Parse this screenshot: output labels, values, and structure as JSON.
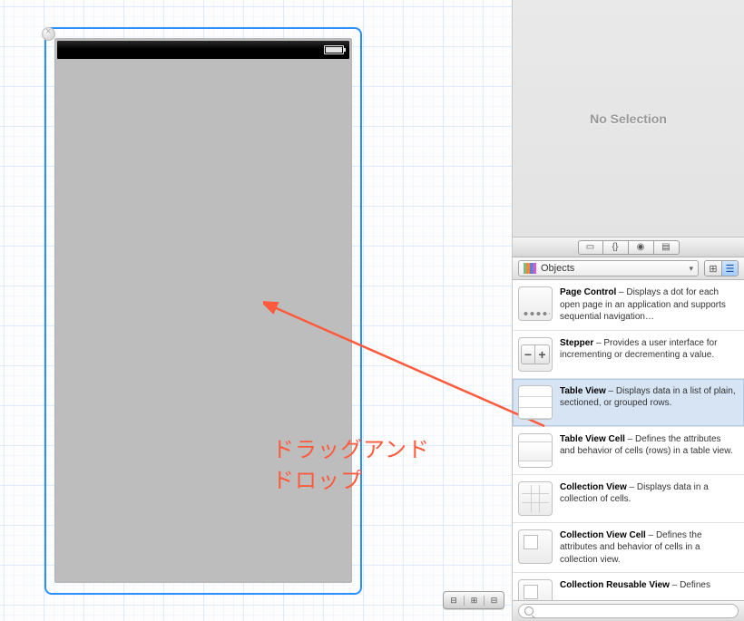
{
  "inspector": {
    "no_selection": "No Selection",
    "library_label": "Objects"
  },
  "library": [
    {
      "name": "Page Control",
      "desc": "Displays a dot for each open page in an application and supports sequential navigation…",
      "thumb": "page"
    },
    {
      "name": "Stepper",
      "desc": "Provides a user interface for incrementing or decrementing a value.",
      "thumb": "stepper"
    },
    {
      "name": "Table View",
      "desc": "Displays data in a list of plain, sectioned, or grouped rows.",
      "thumb": "table",
      "selected": true
    },
    {
      "name": "Table View Cell",
      "desc": "Defines the attributes and behavior of cells (rows) in a table view.",
      "thumb": "tvc"
    },
    {
      "name": "Collection View",
      "desc": "Displays data in a collection of cells.",
      "thumb": "coll"
    },
    {
      "name": "Collection View Cell",
      "desc": "Defines the attributes and behavior of cells in a collection view.",
      "thumb": "collcell"
    },
    {
      "name": "Collection Reusable View",
      "desc": "Defines",
      "thumb": "collcell"
    }
  ],
  "annotation": {
    "line1": "ドラッグアンド",
    "line2": "ドロップ"
  }
}
